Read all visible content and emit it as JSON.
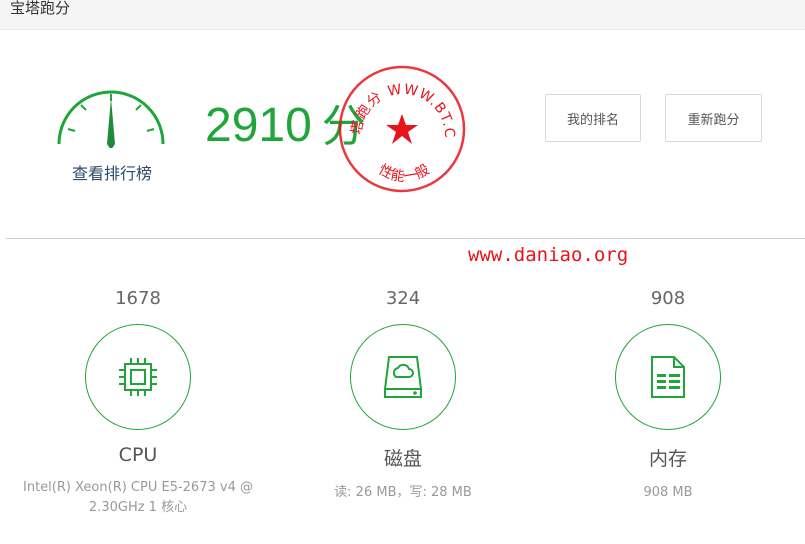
{
  "header": {
    "title": "宝塔跑分"
  },
  "summary": {
    "view_rank_label": "查看排行榜",
    "score": "2910",
    "score_unit": "分"
  },
  "stamp": {
    "top_text": "宝塔跑分 WWW.BT.CN",
    "bottom_text": "性能一般",
    "color": "#e8141c"
  },
  "buttons": {
    "my_rank": "我的排名",
    "rerun": "重新跑分"
  },
  "watermark": "www.daniao.org",
  "metrics": {
    "cpu": {
      "value": "1678",
      "label": "CPU",
      "detail_line1": "Intel(R) Xeon(R) CPU E5-2673 v4 @",
      "detail_line2": "2.30GHz 1 核心",
      "icon": "cpu-chip-icon"
    },
    "disk": {
      "value": "324",
      "label": "磁盘",
      "detail": "读: 26 MB，写: 28 MB",
      "icon": "disk-drive-icon"
    },
    "memory": {
      "value": "908",
      "label": "内存",
      "detail": "908 MB",
      "icon": "memory-doc-icon"
    }
  },
  "colors": {
    "accent": "#20a53a",
    "stamp_red": "#e8141c",
    "link": "#2b4a6b"
  }
}
